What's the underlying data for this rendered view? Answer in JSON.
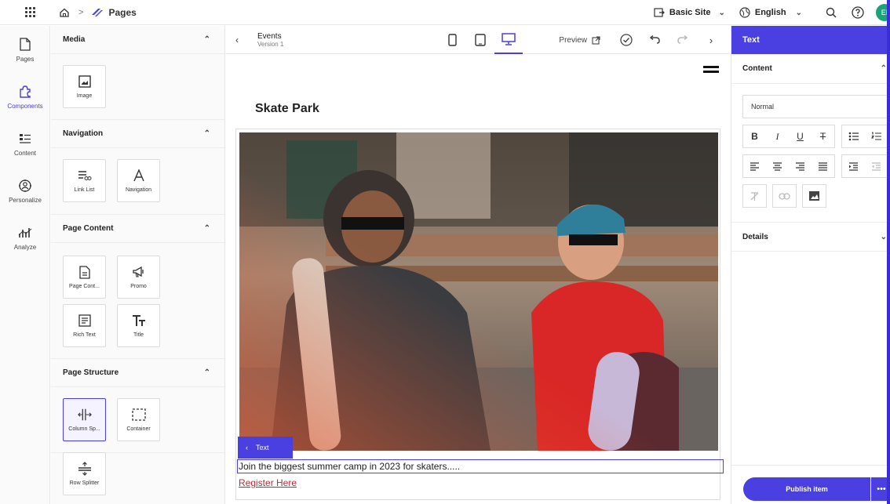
{
  "topbar": {
    "breadcrumb_sep": ">",
    "app_title": "Pages",
    "site": "Basic Site",
    "language": "English",
    "avatar_initials": "EI"
  },
  "rail": [
    {
      "label": "Pages",
      "icon": "page-icon"
    },
    {
      "label": "Components",
      "icon": "puzzle-icon",
      "active": true
    },
    {
      "label": "Content",
      "icon": "content-list-icon"
    },
    {
      "label": "Personalize",
      "icon": "personalize-icon"
    },
    {
      "label": "Analyze",
      "icon": "analyze-icon"
    }
  ],
  "panel": {
    "media": {
      "title": "Media",
      "items": [
        "Image"
      ]
    },
    "navigation": {
      "title": "Navigation",
      "items": [
        "Link List",
        "Navigation"
      ]
    },
    "page_content": {
      "title": "Page Content",
      "items": [
        "Page Cont...",
        "Promo",
        "Rich Text",
        "Title"
      ]
    },
    "page_structure": {
      "title": "Page Structure",
      "items": [
        "Column Sp...",
        "Container",
        "Row Splitter"
      ]
    }
  },
  "canvas_bar": {
    "page_name": "Events",
    "version": "Version 1",
    "preview": "Preview"
  },
  "canvas": {
    "page_title": "Skate Park",
    "text_tag": "Text",
    "body_text": "Join the biggest summer camp in 2023 for skaters.....",
    "link_text": "Register Here"
  },
  "rpanel": {
    "header": "Text",
    "content_section": "Content",
    "style_value": "Normal",
    "details_section": "Details",
    "publish": "Publish item",
    "more": "•••"
  },
  "colors": {
    "accent": "#4a3fe0",
    "link": "#b0303a",
    "avatar": "#1aa37a"
  }
}
